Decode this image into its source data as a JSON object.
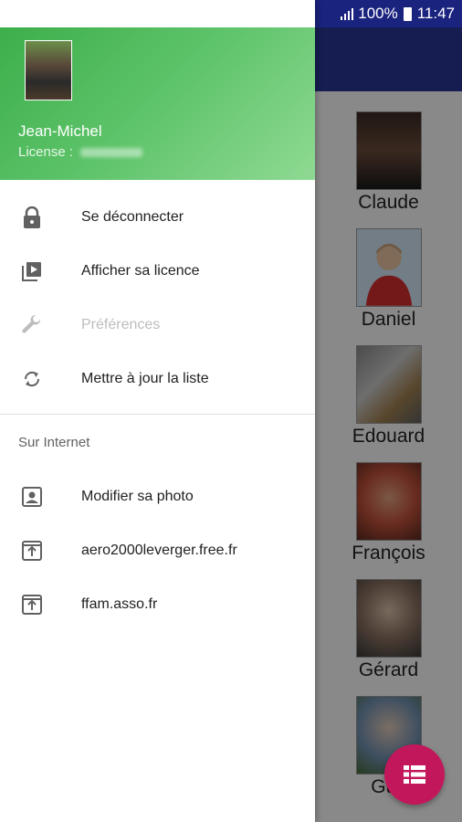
{
  "status_bar": {
    "battery": "100%",
    "time": "11:47"
  },
  "drawer": {
    "header": {
      "user_name": "Jean-Michel",
      "license_label": "License :"
    },
    "items": [
      {
        "label": "Se déconnecter",
        "icon": "lock-icon",
        "enabled": true
      },
      {
        "label": "Afficher sa licence",
        "icon": "play-library-icon",
        "enabled": true
      },
      {
        "label": "Préférences",
        "icon": "wrench-icon",
        "enabled": false
      },
      {
        "label": "Mettre à jour la liste",
        "icon": "sync-icon",
        "enabled": true
      }
    ],
    "section_title": "Sur Internet",
    "internet_items": [
      {
        "label": "Modifier sa photo",
        "icon": "portrait-icon"
      },
      {
        "label": "aero2000leverger.free.fr",
        "icon": "open-link-icon"
      },
      {
        "label": "ffam.asso.fr",
        "icon": "open-link-icon"
      }
    ]
  },
  "contacts": [
    {
      "name": "Claude"
    },
    {
      "name": "Daniel"
    },
    {
      "name": "Edouard"
    },
    {
      "name": "François"
    },
    {
      "name": "Gérard"
    },
    {
      "name": "Guy"
    }
  ],
  "colors": {
    "header_green": "#4caf50",
    "toolbar_blue": "#283593",
    "fab_pink": "#c2185b"
  }
}
